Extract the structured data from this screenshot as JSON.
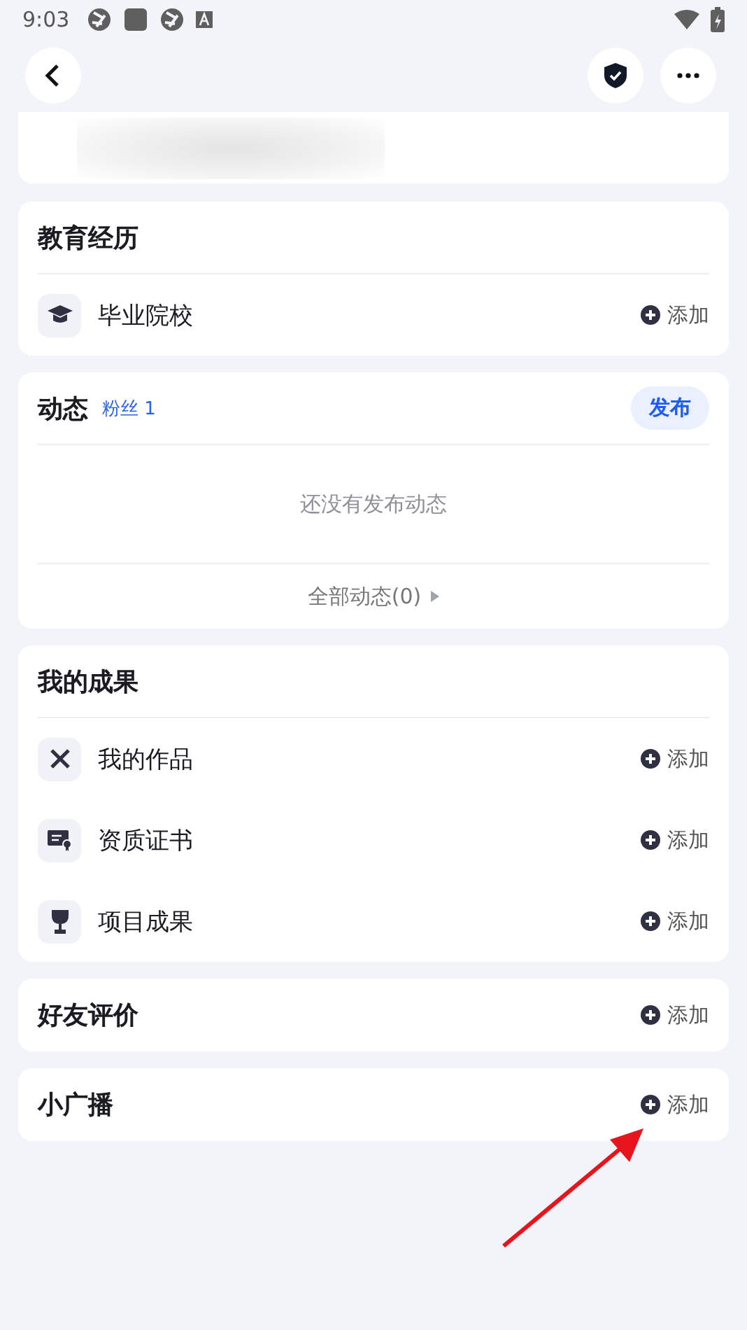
{
  "status_bar": {
    "time": "9:03"
  },
  "sections": [
    {
      "kind": "list",
      "title": "教育经历",
      "items": [
        {
          "label": "毕业院校",
          "action": "添加"
        }
      ]
    },
    {
      "kind": "feed",
      "title": "动态",
      "fans": "粉丝 1",
      "button": "发布",
      "empty": "还没有发布动态",
      "more": "全部动态(0)"
    },
    {
      "kind": "list",
      "title": "我的成果",
      "items": [
        {
          "label": "我的作品",
          "action": "添加"
        },
        {
          "label": "资质证书",
          "action": "添加"
        },
        {
          "label": "项目成果",
          "action": "添加"
        }
      ]
    },
    {
      "kind": "single",
      "title": "好友评价",
      "action": "添加"
    },
    {
      "kind": "single",
      "title": "小广播",
      "action": "添加"
    }
  ]
}
